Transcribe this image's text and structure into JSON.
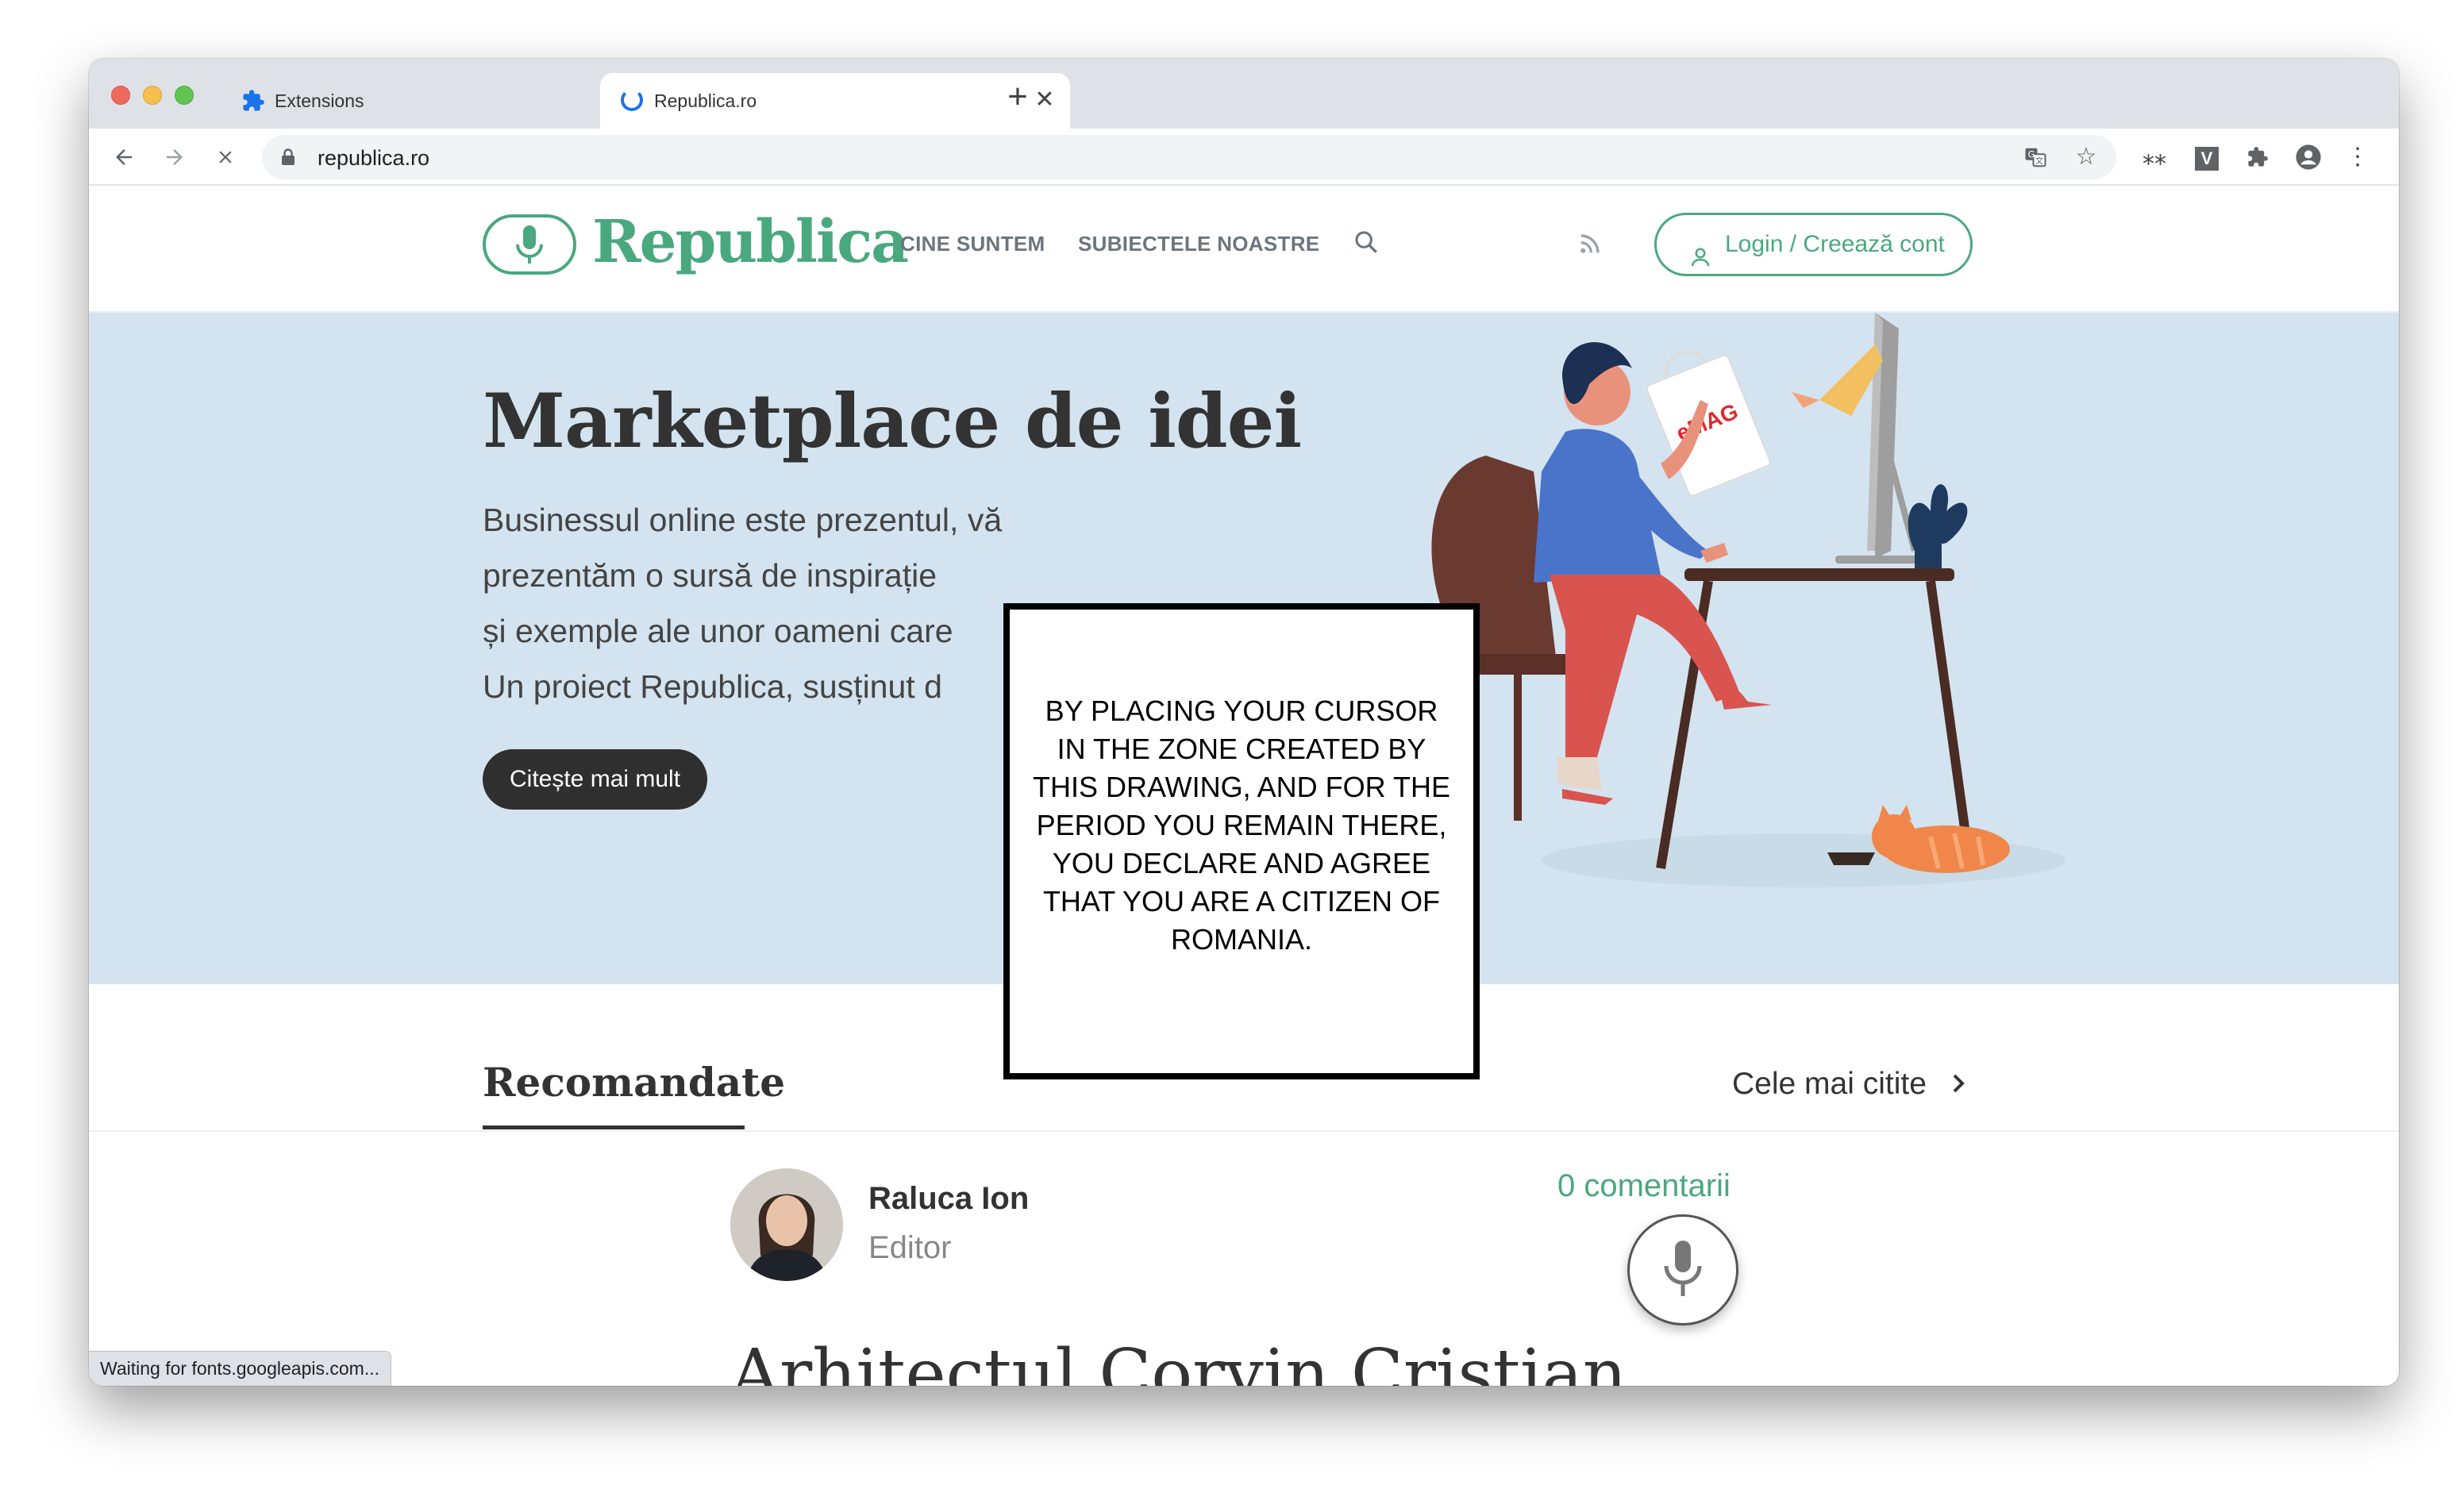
{
  "browser": {
    "tabs": [
      {
        "title": "Extensions",
        "icon": "puzzle-icon",
        "active": false
      },
      {
        "title": "Republica.ro",
        "icon": "loading-spinner-icon",
        "active": true
      }
    ],
    "url": "republica.ro",
    "status_text": "Waiting for fonts.googleapis.com...",
    "extension_letter": "V"
  },
  "header": {
    "logo_text": "Republica",
    "nav": [
      "CINE SUNTEM",
      "SUBIECTELE NOASTRE"
    ],
    "login_label": "Login / Creează cont"
  },
  "hero": {
    "title": "Marketplace de idei",
    "lines": [
      "Businessul online este prezentul, vă",
      "prezentăm o sursă de inspirație",
      "și exemple ale unor oameni care",
      "Un proiect Republica, susținut d"
    ],
    "button_label": "Citește mai mult",
    "bag_brand": "eMAG",
    "colors": {
      "background": "#d3e3ef",
      "accent": "#4aa87e"
    }
  },
  "overlay": {
    "text": "BY PLACING YOUR CURSOR IN THE ZONE CREATED BY THIS DRAWING, AND FOR THE PERIOD YOU REMAIN THERE, YOU DECLARE AND AGREE THAT YOU ARE A CITIZEN OF ROMANIA."
  },
  "recommended": {
    "title": "Recomandate",
    "most_read": "Cele mai citite",
    "author_name": "Raluca Ion",
    "author_role": "Editor",
    "comments": "0 comentarii",
    "article_title": "Arhitectul Corvin Cristian"
  }
}
